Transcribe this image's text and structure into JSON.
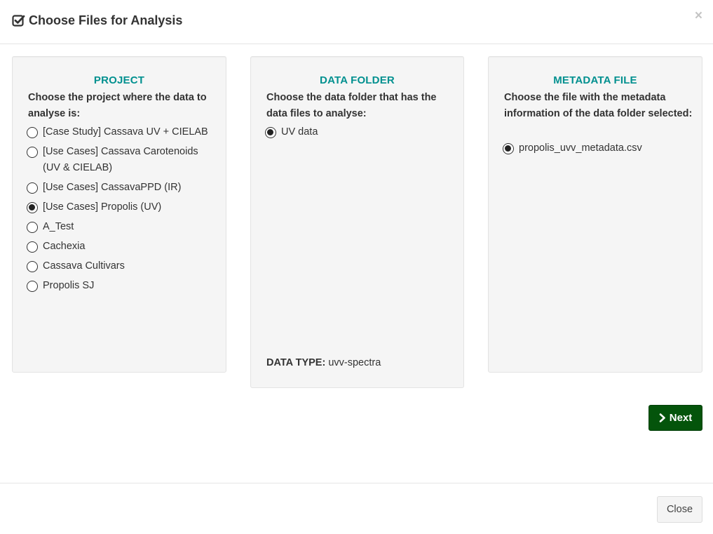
{
  "dialog": {
    "title": "Choose Files for Analysis",
    "close_symbol": "×",
    "title_icon": "check-square-icon"
  },
  "project": {
    "heading": "PROJECT",
    "instruction": "Choose the project where the data to analyse is:",
    "options": [
      {
        "label": "[Case Study] Cassava UV + CIELAB",
        "checked": false
      },
      {
        "label": "[Use Cases] Cassava Carotenoids (UV & CIELAB)",
        "checked": false
      },
      {
        "label": "[Use Cases] CassavaPPD (IR)",
        "checked": false
      },
      {
        "label": "[Use Cases] Propolis (UV)",
        "checked": true
      },
      {
        "label": "A_Test",
        "checked": false
      },
      {
        "label": "Cachexia",
        "checked": false
      },
      {
        "label": "Cassava Cultivars",
        "checked": false
      },
      {
        "label": "Propolis SJ",
        "checked": false
      }
    ]
  },
  "data_folder": {
    "heading": "DATA FOLDER",
    "instruction": "Choose the data folder that has the data files to analyse:",
    "options": [
      {
        "label": "UV data",
        "checked": true
      }
    ],
    "data_type_label": "DATA TYPE:",
    "data_type_value": "uvv-spectra"
  },
  "metadata": {
    "heading": "METADATA FILE",
    "instruction": "Choose the file with the metadata information of the data folder selected:",
    "options": [
      {
        "label": "propolis_uvv_metadata.csv",
        "checked": true
      }
    ]
  },
  "buttons": {
    "next_label": "Next",
    "next_icon": "chevron-right-icon",
    "close_label": "Close"
  },
  "colors": {
    "heading_teal": "#00908f",
    "next_green": "#04540b"
  }
}
